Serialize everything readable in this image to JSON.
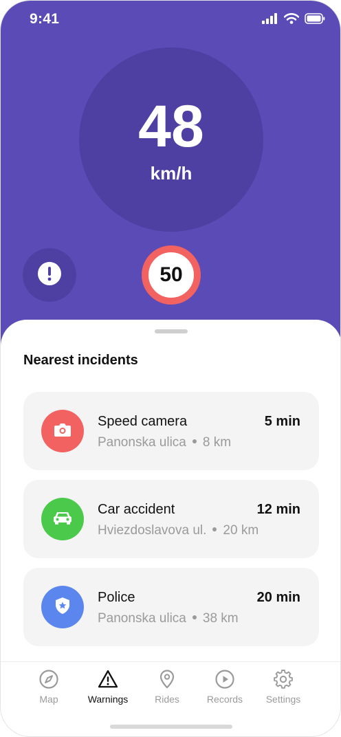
{
  "status_bar": {
    "time": "9:41",
    "icons": [
      "signal-icon",
      "wifi-icon",
      "battery-icon"
    ]
  },
  "speedometer": {
    "speed": "48",
    "unit": "km/h"
  },
  "speed_limit": {
    "value": "50",
    "ring_color": "#f26260"
  },
  "report_button": {
    "icon": "exclamation-icon"
  },
  "incidents": {
    "title": "Nearest incidents",
    "items": [
      {
        "title": "Speed camera",
        "time": "5 min",
        "street": "Panonska ulica",
        "distance": "8 km",
        "icon": "camera-icon",
        "color": "#f26260"
      },
      {
        "title": "Car accident",
        "time": "12 min",
        "street": "Hviezdoslavova ul.",
        "distance": "20 km",
        "icon": "car-icon",
        "color": "#4bc94a"
      },
      {
        "title": "Police",
        "time": "20 min",
        "street": "Panonska ulica",
        "distance": "38 km",
        "icon": "police-badge-icon",
        "color": "#5a86ee"
      }
    ]
  },
  "tabbar": {
    "active": "Warnings",
    "tabs": [
      {
        "label": "Map",
        "icon": "compass-icon"
      },
      {
        "label": "Warnings",
        "icon": "warning-triangle-icon"
      },
      {
        "label": "Rides",
        "icon": "location-pin-icon"
      },
      {
        "label": "Records",
        "icon": "play-circle-icon"
      },
      {
        "label": "Settings",
        "icon": "gear-icon"
      }
    ]
  },
  "colors": {
    "primary": "#5a4bb6",
    "primary_dark": "#4e3fa3",
    "card_bg": "#f4f4f4",
    "muted_text": "#9a9a9a"
  }
}
